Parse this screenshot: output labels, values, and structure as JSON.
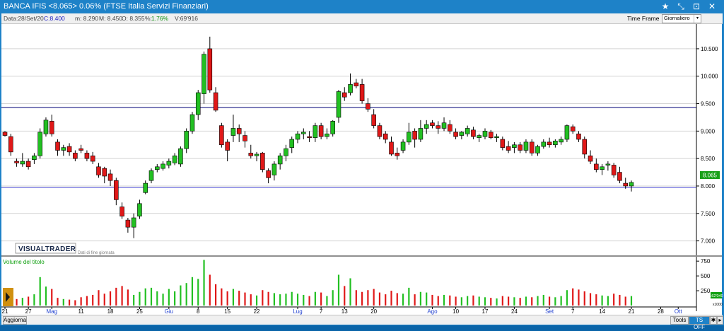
{
  "window": {
    "title": "BANCA IFIS <8.065> 0.06%  (FTSE Italia Servizi Finanziari)",
    "controls": [
      "★",
      "⤡",
      "⊡",
      "✕"
    ]
  },
  "info_bar": {
    "data": "Data:28/Set/20",
    "close": "C:8.400",
    "min": "m: 8.290",
    "max": "M: 8.450",
    "open": "O: 8.355",
    "pct_label": "%:",
    "pct": "1.76%",
    "volume": "V:69'916"
  },
  "timeframe": {
    "label": "Time Frame",
    "selected": "Giornaliero"
  },
  "logo": {
    "text": "VISUALTRADER",
    "subtitle": "Dati di fine giornata"
  },
  "price_badge": "8.065",
  "volume_badge": "162'040",
  "volume_title": "Volume del titolo",
  "volume_unit": "x1000",
  "bottom": {
    "aggiorna": "Aggiorna",
    "tools": "Tools",
    "tsoff": "TS OFF"
  },
  "colors": {
    "up": "#22c022",
    "down": "#e01818",
    "hline_res": "#303090",
    "hline_sup": "#8080e0"
  },
  "chart_data": {
    "type": "candlestick",
    "y_ticks": [
      "10.500",
      "10.000",
      "9.500",
      "9.000",
      "8.500",
      "8.000",
      "7.500",
      "7.000"
    ],
    "ylim": [
      6.75,
      10.95
    ],
    "resistance": 9.43,
    "support": 7.97,
    "vol_ticks": [
      "750",
      "500",
      "250"
    ],
    "x_labels": [
      {
        "t": "21",
        "i": 0,
        "m": false
      },
      {
        "t": "27",
        "i": 4,
        "m": false
      },
      {
        "t": "Mag",
        "i": 8,
        "m": true
      },
      {
        "t": "11",
        "i": 13,
        "m": false
      },
      {
        "t": "18",
        "i": 18,
        "m": false
      },
      {
        "t": "25",
        "i": 23,
        "m": false
      },
      {
        "t": "Giu",
        "i": 28,
        "m": true
      },
      {
        "t": "8",
        "i": 33,
        "m": false
      },
      {
        "t": "15",
        "i": 38,
        "m": false
      },
      {
        "t": "22",
        "i": 43,
        "m": false
      },
      {
        "t": "Lug",
        "i": 50,
        "m": true
      },
      {
        "t": "7",
        "i": 54,
        "m": false
      },
      {
        "t": "13",
        "i": 58,
        "m": false
      },
      {
        "t": "20",
        "i": 63,
        "m": false
      },
      {
        "t": "Ago",
        "i": 73,
        "m": true
      },
      {
        "t": "10",
        "i": 77,
        "m": false
      },
      {
        "t": "17",
        "i": 82,
        "m": false
      },
      {
        "t": "24",
        "i": 87,
        "m": false
      },
      {
        "t": "Set",
        "i": 93,
        "m": true
      },
      {
        "t": "7",
        "i": 97,
        "m": false
      },
      {
        "t": "14",
        "i": 102,
        "m": false
      },
      {
        "t": "21",
        "i": 107,
        "m": false
      },
      {
        "t": "28",
        "i": 112,
        "m": false
      },
      {
        "t": "Ott",
        "i": 115,
        "m": true
      }
    ],
    "candles": [
      [
        8.98,
        9.0,
        8.9,
        8.92,
        160
      ],
      [
        8.9,
        8.95,
        8.55,
        8.62,
        120
      ],
      [
        8.45,
        8.5,
        8.35,
        8.42,
        110
      ],
      [
        8.4,
        8.6,
        8.35,
        8.45,
        130
      ],
      [
        8.45,
        8.5,
        8.3,
        8.35,
        150
      ],
      [
        8.48,
        8.6,
        8.4,
        8.55,
        190
      ],
      [
        8.55,
        9.05,
        8.5,
        8.98,
        480
      ],
      [
        8.95,
        9.25,
        8.9,
        9.2,
        320
      ],
      [
        9.18,
        9.3,
        8.9,
        8.95,
        280
      ],
      [
        8.8,
        8.85,
        8.55,
        8.65,
        130
      ],
      [
        8.65,
        8.75,
        8.55,
        8.7,
        110
      ],
      [
        8.72,
        8.78,
        8.55,
        8.62,
        100
      ],
      [
        8.6,
        8.65,
        8.45,
        8.5,
        90
      ],
      [
        8.68,
        8.75,
        8.6,
        8.65,
        140
      ],
      [
        8.6,
        8.65,
        8.45,
        8.5,
        160
      ],
      [
        8.55,
        8.62,
        8.4,
        8.45,
        180
      ],
      [
        8.35,
        8.42,
        8.15,
        8.2,
        260
      ],
      [
        8.32,
        8.35,
        8.05,
        8.18,
        200
      ],
      [
        8.22,
        8.3,
        8.0,
        8.1,
        240
      ],
      [
        8.1,
        8.15,
        7.65,
        7.75,
        300
      ],
      [
        7.62,
        7.7,
        7.4,
        7.45,
        330
      ],
      [
        7.38,
        7.42,
        7.15,
        7.25,
        270
      ],
      [
        7.25,
        7.5,
        7.05,
        7.42,
        180
      ],
      [
        7.45,
        7.75,
        7.4,
        7.68,
        230
      ],
      [
        7.88,
        8.1,
        7.85,
        8.05,
        290
      ],
      [
        8.1,
        8.32,
        8.05,
        8.28,
        300
      ],
      [
        8.3,
        8.4,
        8.25,
        8.35,
        240
      ],
      [
        8.32,
        8.45,
        8.28,
        8.4,
        200
      ],
      [
        8.38,
        8.5,
        8.32,
        8.45,
        280
      ],
      [
        8.42,
        8.6,
        8.38,
        8.55,
        240
      ],
      [
        8.4,
        8.72,
        8.35,
        8.68,
        340
      ],
      [
        8.68,
        9.05,
        8.6,
        9.0,
        380
      ],
      [
        9.0,
        9.35,
        8.95,
        9.3,
        480
      ],
      [
        9.3,
        9.75,
        9.2,
        9.7,
        450
      ],
      [
        9.68,
        10.45,
        9.5,
        10.4,
        770
      ],
      [
        10.5,
        10.72,
        9.7,
        9.75,
        520
      ],
      [
        9.7,
        9.8,
        9.35,
        9.38,
        360
      ],
      [
        9.1,
        9.15,
        8.7,
        8.75,
        290
      ],
      [
        8.8,
        8.85,
        8.45,
        8.65,
        240
      ],
      [
        8.92,
        9.3,
        8.8,
        9.05,
        280
      ],
      [
        9.05,
        9.12,
        8.8,
        8.95,
        250
      ],
      [
        8.92,
        9.0,
        8.7,
        8.82,
        220
      ],
      [
        8.6,
        8.75,
        8.5,
        8.55,
        190
      ],
      [
        8.55,
        8.62,
        8.45,
        8.58,
        170
      ],
      [
        8.6,
        8.62,
        8.25,
        8.3,
        260
      ],
      [
        8.28,
        8.32,
        8.05,
        8.15,
        230
      ],
      [
        8.2,
        8.45,
        8.1,
        8.4,
        210
      ],
      [
        8.4,
        8.6,
        8.3,
        8.55,
        190
      ],
      [
        8.55,
        8.75,
        8.45,
        8.68,
        200
      ],
      [
        8.7,
        8.9,
        8.6,
        8.85,
        230
      ],
      [
        8.85,
        9.0,
        8.78,
        8.95,
        200
      ],
      [
        8.95,
        9.05,
        8.85,
        8.98,
        180
      ],
      [
        8.9,
        9.0,
        8.8,
        8.88,
        160
      ],
      [
        8.88,
        9.15,
        8.8,
        9.1,
        230
      ],
      [
        9.1,
        9.15,
        8.85,
        8.9,
        220
      ],
      [
        8.9,
        9.05,
        8.85,
        8.95,
        160
      ],
      [
        8.95,
        9.2,
        8.9,
        9.18,
        260
      ],
      [
        9.25,
        9.75,
        9.15,
        9.72,
        520
      ],
      [
        9.7,
        9.8,
        9.55,
        9.62,
        330
      ],
      [
        9.7,
        10.05,
        9.65,
        9.85,
        460
      ],
      [
        9.88,
        9.95,
        9.78,
        9.82,
        260
      ],
      [
        9.85,
        9.95,
        9.5,
        9.55,
        230
      ],
      [
        9.5,
        9.6,
        9.35,
        9.4,
        260
      ],
      [
        9.3,
        9.4,
        9.05,
        9.1,
        280
      ],
      [
        9.1,
        9.15,
        8.85,
        8.9,
        220
      ],
      [
        8.95,
        9.0,
        8.78,
        8.85,
        190
      ],
      [
        8.8,
        8.9,
        8.55,
        8.58,
        250
      ],
      [
        8.6,
        8.7,
        8.48,
        8.55,
        210
      ],
      [
        8.65,
        8.85,
        8.6,
        8.8,
        200
      ],
      [
        8.8,
        9.15,
        8.75,
        8.98,
        300
      ],
      [
        9.0,
        9.05,
        8.7,
        8.85,
        190
      ],
      [
        8.85,
        9.2,
        8.8,
        9.05,
        230
      ],
      [
        9.05,
        9.2,
        8.95,
        9.12,
        220
      ],
      [
        9.15,
        9.2,
        9.05,
        9.1,
        180
      ],
      [
        9.1,
        9.18,
        8.95,
        9.05,
        160
      ],
      [
        9.05,
        9.25,
        9.0,
        9.15,
        180
      ],
      [
        9.12,
        9.2,
        8.95,
        9.0,
        170
      ],
      [
        8.98,
        9.05,
        8.85,
        8.9,
        150
      ],
      [
        8.92,
        9.0,
        8.85,
        8.98,
        140
      ],
      [
        8.95,
        9.1,
        8.9,
        9.05,
        160
      ],
      [
        9.02,
        9.08,
        8.85,
        8.9,
        170
      ],
      [
        8.88,
        8.95,
        8.8,
        8.92,
        150
      ],
      [
        8.9,
        9.05,
        8.85,
        9.0,
        140
      ],
      [
        8.98,
        9.02,
        8.85,
        8.88,
        130
      ],
      [
        8.88,
        8.95,
        8.8,
        8.9,
        120
      ],
      [
        8.85,
        8.9,
        8.65,
        8.7,
        160
      ],
      [
        8.72,
        8.82,
        8.6,
        8.65,
        150
      ],
      [
        8.7,
        8.8,
        8.6,
        8.75,
        140
      ],
      [
        8.75,
        8.8,
        8.6,
        8.65,
        130
      ],
      [
        8.65,
        8.85,
        8.6,
        8.8,
        150
      ],
      [
        8.8,
        8.85,
        8.55,
        8.6,
        140
      ],
      [
        8.6,
        8.75,
        8.55,
        8.72,
        160
      ],
      [
        8.72,
        8.85,
        8.68,
        8.8,
        180
      ],
      [
        8.8,
        8.88,
        8.7,
        8.75,
        150
      ],
      [
        8.75,
        8.85,
        8.7,
        8.82,
        140
      ],
      [
        8.8,
        8.9,
        8.75,
        8.85,
        160
      ],
      [
        8.85,
        9.12,
        8.8,
        9.1,
        260
      ],
      [
        9.08,
        9.12,
        8.95,
        9.0,
        290
      ],
      [
        8.95,
        9.0,
        8.8,
        8.85,
        270
      ],
      [
        8.85,
        8.9,
        8.5,
        8.58,
        240
      ],
      [
        8.55,
        8.65,
        8.4,
        8.45,
        210
      ],
      [
        8.4,
        8.5,
        8.25,
        8.3,
        190
      ],
      [
        8.3,
        8.4,
        8.2,
        8.35,
        170
      ],
      [
        8.38,
        8.45,
        8.28,
        8.4,
        160
      ],
      [
        8.38,
        8.42,
        8.15,
        8.2,
        200
      ],
      [
        8.25,
        8.35,
        8.05,
        8.1,
        180
      ],
      [
        8.05,
        8.15,
        7.95,
        8.0,
        150
      ],
      [
        8.0,
        8.1,
        7.9,
        8.065,
        160
      ]
    ]
  }
}
